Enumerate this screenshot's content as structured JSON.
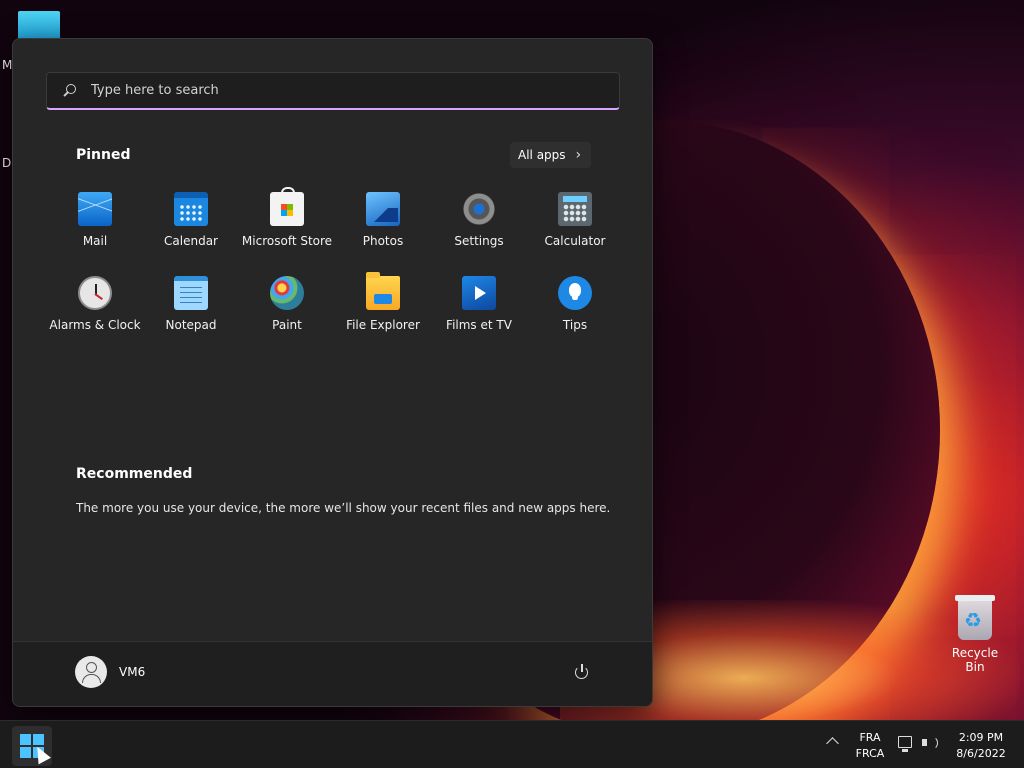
{
  "desktop": {
    "fragment_top": "M",
    "fragment_mid": "Da",
    "recycle_bin_label": "Recycle Bin"
  },
  "start_menu": {
    "search": {
      "placeholder": "Type here to search",
      "value": ""
    },
    "pinned": {
      "title": "Pinned",
      "all_apps_label": "All apps",
      "apps": [
        {
          "label": "Mail",
          "icon": "mail-icon"
        },
        {
          "label": "Calendar",
          "icon": "calendar-icon"
        },
        {
          "label": "Microsoft Store",
          "icon": "microsoft-store-icon"
        },
        {
          "label": "Photos",
          "icon": "photos-icon"
        },
        {
          "label": "Settings",
          "icon": "settings-icon"
        },
        {
          "label": "Calculator",
          "icon": "calculator-icon"
        },
        {
          "label": "Alarms & Clock",
          "icon": "alarm-clock-icon"
        },
        {
          "label": "Notepad",
          "icon": "notepad-icon"
        },
        {
          "label": "Paint",
          "icon": "paint-icon"
        },
        {
          "label": "File Explorer",
          "icon": "folder-icon"
        },
        {
          "label": "Films et TV",
          "icon": "films-tv-icon"
        },
        {
          "label": "Tips",
          "icon": "tips-icon"
        }
      ]
    },
    "recommended": {
      "title": "Recommended",
      "empty_text": "The more you use your device, the more we’ll show your recent files and new apps here."
    },
    "footer": {
      "user_name": "VM6"
    }
  },
  "taskbar": {
    "language_line1": "FRA",
    "language_line2": "FRCA",
    "time": "2:09 PM",
    "date": "8/6/2022"
  },
  "colors": {
    "accent": "#4cc2ff",
    "search_underline": "#d9a3ff",
    "menu_bg": "#262626"
  }
}
